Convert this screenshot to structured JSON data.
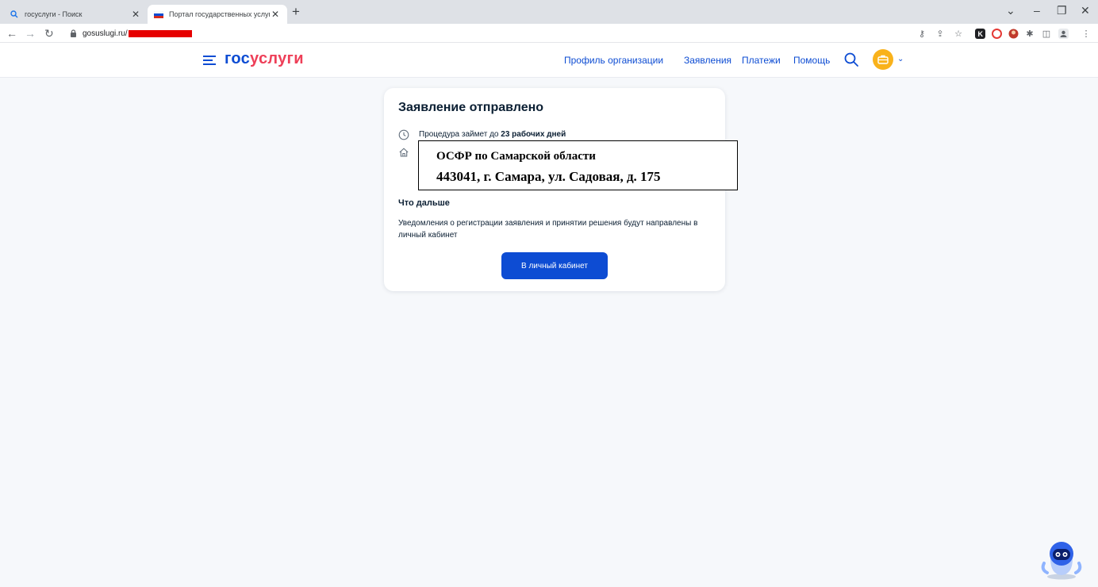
{
  "browser": {
    "tabs": [
      {
        "title": "госуслуги - Поиск",
        "active": false
      },
      {
        "title": "Портал государственных услуг",
        "active": true
      }
    ],
    "url": "gosuslugi.ru/"
  },
  "header": {
    "logo": {
      "part1": "гос",
      "part2": "услуги"
    },
    "nav": [
      "Профиль организации",
      "Заявления",
      "Платежи",
      "Помощь"
    ],
    "icons": {
      "search": "search-icon",
      "avatar": "briefcase-avatar-icon"
    }
  },
  "card": {
    "title": "Заявление отправлено",
    "procedure": {
      "prefix": "Процедура займет до",
      "bold": "23 рабочих дней"
    },
    "stamp": {
      "line1": "ОСФР по Самарской области",
      "line2": "443041, г. Самара, ул. Садовая, д. 175"
    },
    "next_title": "Что дальше",
    "next_text": "Уведомления о регистрации заявления и принятии решения будут направлены в личный кабинет",
    "button": "В личный кабинет"
  },
  "colors": {
    "brand_blue": "#0d4cd3",
    "brand_red": "#ee3f58",
    "page_bg": "#f6f8fb",
    "avatar": "#f9b21b"
  }
}
